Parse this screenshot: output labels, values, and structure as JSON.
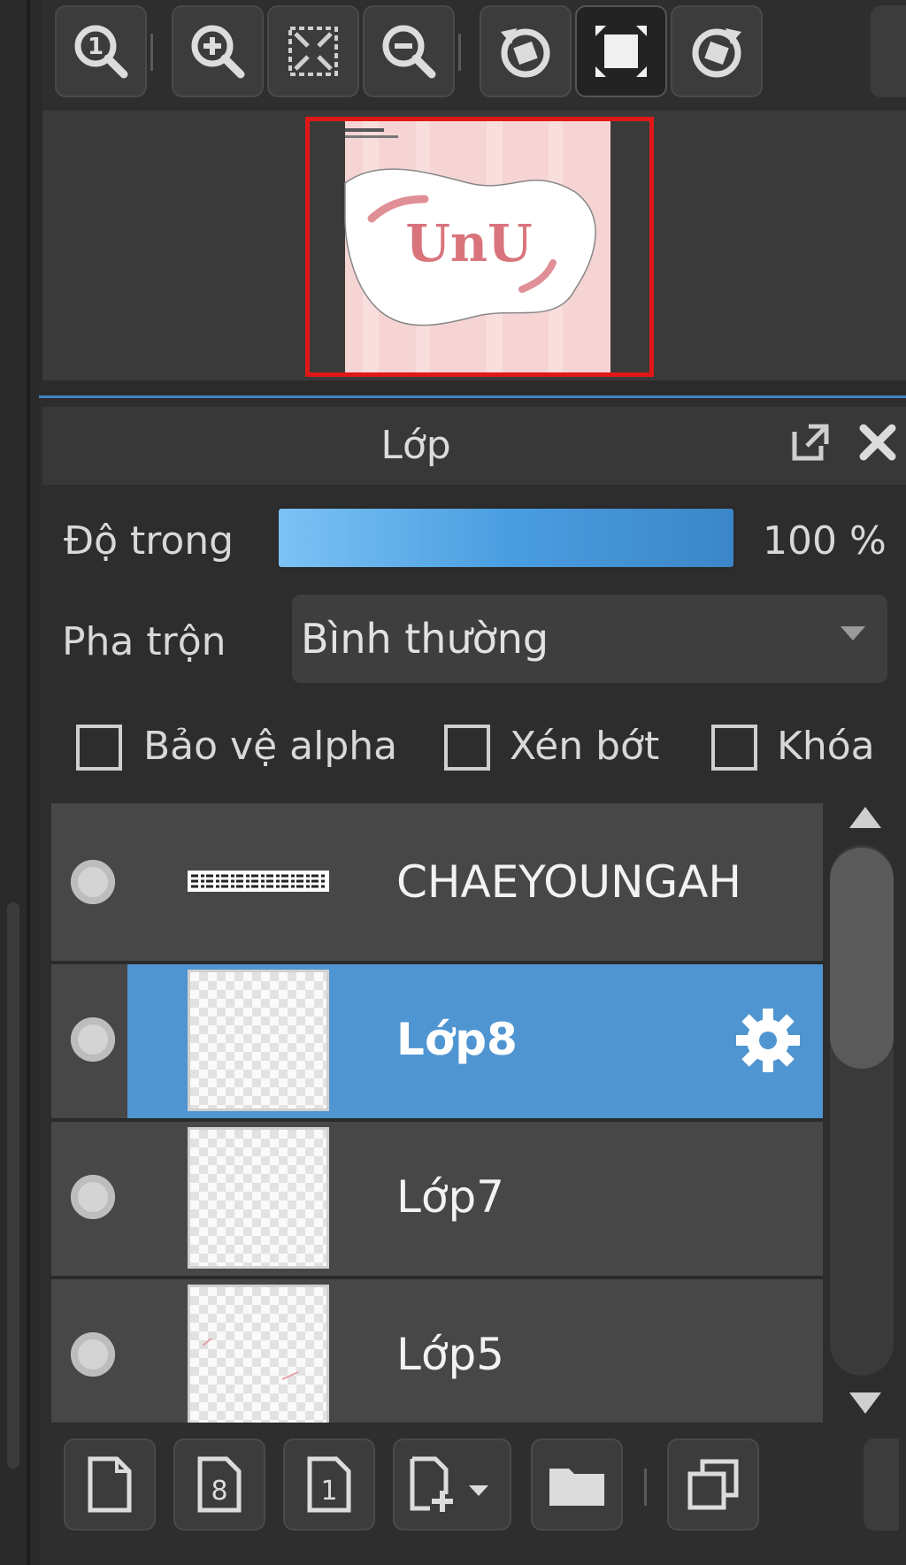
{
  "navigator": {
    "toolbar": {
      "buttons": [
        {
          "icon": "zoom-actual-size-icon"
        },
        {
          "icon": "zoom-in-icon"
        },
        {
          "icon": "fit-to-window-icon"
        },
        {
          "icon": "zoom-out-icon"
        },
        {
          "icon": "rotate-left-icon"
        },
        {
          "icon": "reset-rotation-icon"
        },
        {
          "icon": "rotate-right-icon"
        }
      ]
    },
    "preview": {
      "artwork_text": "UnU"
    }
  },
  "layer_panel": {
    "title": "Lớp",
    "opacity_label": "Độ trong",
    "opacity_value": "100 %",
    "opacity": 1.0,
    "blend_label": "Pha trộn",
    "blend_value": "Bình thường",
    "checkboxes": [
      {
        "label": "Bảo vệ alpha",
        "checked": false
      },
      {
        "label": "Xén bớt",
        "checked": false
      },
      {
        "label": "Khóa",
        "checked": false
      }
    ],
    "layers": [
      {
        "name": "CHAEYOUNGAH",
        "selected": false,
        "type": "text"
      },
      {
        "name": "Lớp8",
        "selected": true,
        "type": "raster"
      },
      {
        "name": "Lớp7",
        "selected": false,
        "type": "raster"
      },
      {
        "name": "Lớp5",
        "selected": false,
        "type": "raster"
      }
    ]
  },
  "bottom_toolbar": {
    "buttons": [
      {
        "icon": "new-layer-icon"
      },
      {
        "icon": "new-8bit-layer-icon"
      },
      {
        "icon": "new-1bit-layer-icon"
      },
      {
        "icon": "add-layer-dropdown-icon"
      },
      {
        "icon": "folder-icon"
      },
      {
        "icon": "duplicate-layer-icon"
      }
    ]
  },
  "colors": {
    "accent": "#4f95d1",
    "selection_frame": "#e01818",
    "panel_bg": "#2d2d2d"
  }
}
